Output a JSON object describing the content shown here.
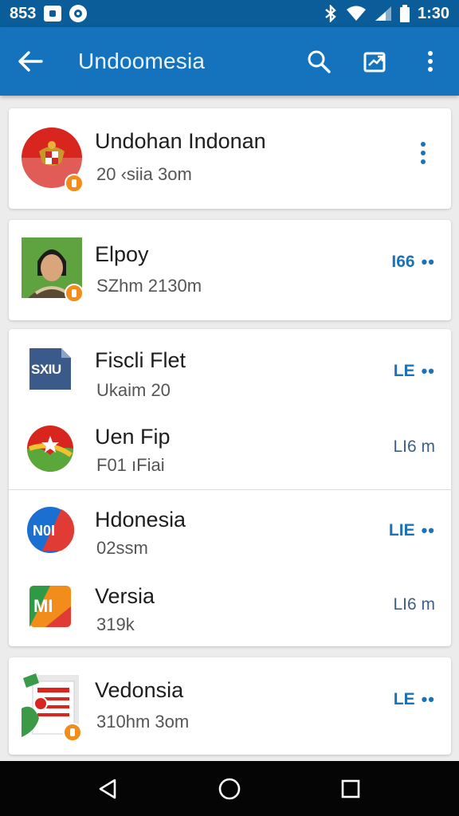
{
  "status_bar": {
    "left_text": "853",
    "time": "1:30"
  },
  "app_bar": {
    "title": "Undoomesia",
    "back_icon": "arrow-left-icon",
    "action_icons": [
      "search-icon",
      "share-icon",
      "more-vert-icon"
    ]
  },
  "items": [
    {
      "name": "Undohan Indonan",
      "sub": "20 ‹siia 3om",
      "action": "",
      "icon": "garuda-emblem-icon"
    },
    {
      "name": "Elpoy",
      "sub": "SZhm 2130m",
      "action": "I66",
      "icon": "portrait-photo"
    },
    {
      "name": "Fiscli Flet",
      "sub": "Ukaim 20",
      "action": "LE",
      "icon": "sxiu-app-icon",
      "icon_text": "SXIU"
    },
    {
      "name": "Uen Fip",
      "sub": "F01 ıFiai",
      "action": "LI6 m",
      "icon": "flag-ball-icon"
    },
    {
      "name": "Hdonesia",
      "sub": "02ssm",
      "action": "LIE",
      "icon": "noi-app-icon",
      "icon_text": "N0I"
    },
    {
      "name": "Versia",
      "sub": "319k",
      "action": "LI6 m",
      "icon": "mi-app-icon",
      "icon_text": "MI"
    },
    {
      "name": "Vedonsia",
      "sub": "310hm 3om",
      "action": "LE",
      "icon": "news-stack-icon"
    }
  ],
  "colors": {
    "status_bar": "#0b5d99",
    "app_bar": "#1473bc",
    "accent": "#1a73b8",
    "badge": "#f28c1a",
    "nav_bar": "#050505"
  },
  "nav_icons": [
    "back-triangle-icon",
    "home-circle-icon",
    "recents-square-icon"
  ]
}
